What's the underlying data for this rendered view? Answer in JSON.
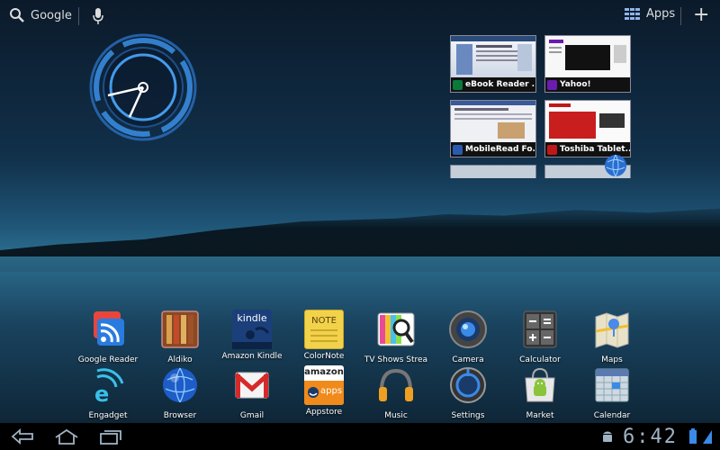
{
  "topbar": {
    "search_label": "Google",
    "apps_label": "Apps",
    "add_label": "+"
  },
  "bookmarks": [
    {
      "label": "eBook Reader ...",
      "icon_color": "#0a7a3a",
      "icon_text": "E"
    },
    {
      "label": "Yahoo!",
      "icon_color": "#6a1bb0",
      "icon_text": "Y"
    },
    {
      "label": "MobileRead Fo...",
      "icon_color": "#2a5ab0",
      "icon_text": ""
    },
    {
      "label": "Toshiba Tablet...",
      "icon_color": "#c01818",
      "icon_text": ""
    }
  ],
  "apps_row1": [
    {
      "name": "Google Reader",
      "icon": "google-reader-icon"
    },
    {
      "name": "Aldiko",
      "icon": "aldiko-icon"
    },
    {
      "name": "Amazon Kindle",
      "icon": "kindle-icon",
      "icon_text": "kindle"
    },
    {
      "name": "ColorNote",
      "icon": "colornote-icon",
      "icon_text": "NOTE"
    },
    {
      "name": "TV Shows Strea",
      "icon": "tv-shows-icon"
    },
    {
      "name": "Camera",
      "icon": "camera-icon"
    },
    {
      "name": "Calculator",
      "icon": "calculator-icon"
    },
    {
      "name": "Maps",
      "icon": "maps-icon"
    }
  ],
  "apps_row2": [
    {
      "name": "Engadget",
      "icon": "engadget-icon"
    },
    {
      "name": "Browser",
      "icon": "browser-icon"
    },
    {
      "name": "Gmail",
      "icon": "gmail-icon"
    },
    {
      "name": "Appstore",
      "icon": "appstore-icon",
      "icon_text_top": "amazon",
      "icon_text_bottom": "apps"
    },
    {
      "name": "Music",
      "icon": "music-icon"
    },
    {
      "name": "Settings",
      "icon": "settings-icon"
    },
    {
      "name": "Market",
      "icon": "market-icon"
    },
    {
      "name": "Calendar",
      "icon": "calendar-icon"
    }
  ],
  "status": {
    "time": "6:42"
  },
  "colors": {
    "accent": "#4aa8ff"
  }
}
